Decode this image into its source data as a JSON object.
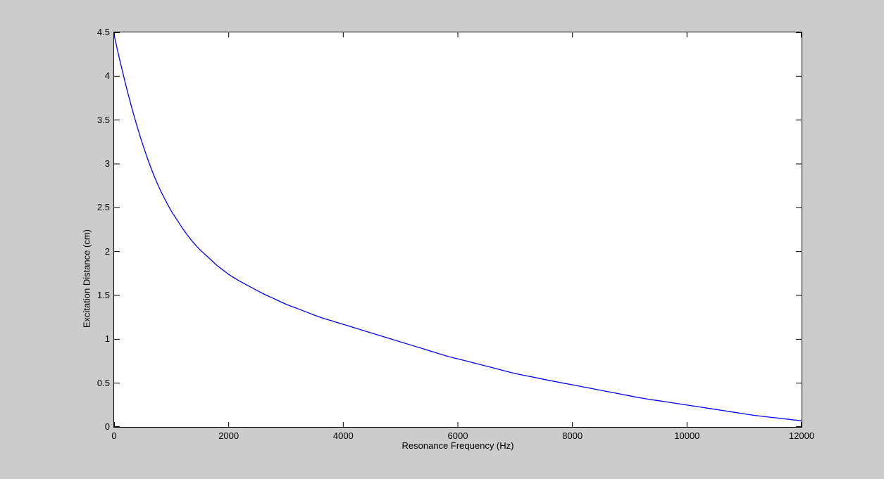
{
  "colors": {
    "figure_bg": "#cccccc",
    "plot_bg": "#ffffff",
    "axis_color": "#000000",
    "line_color": "#0000ff",
    "text_color": "#000000"
  },
  "chart_data": {
    "type": "line",
    "title": "",
    "xlabel": "Resonance Frequency (Hz)",
    "ylabel": "Excitation Distance (cm)",
    "xlim": [
      0,
      12000
    ],
    "ylim": [
      0,
      4.5
    ],
    "grid": false,
    "legend": "none",
    "box": true,
    "series": [
      {
        "name": "excitation-distance-vs-resonance-frequency",
        "color": "#0000ff",
        "points": [
          [
            0,
            4.47
          ],
          [
            100,
            4.18
          ],
          [
            200,
            3.91
          ],
          [
            300,
            3.66
          ],
          [
            400,
            3.43
          ],
          [
            500,
            3.22
          ],
          [
            600,
            3.03
          ],
          [
            700,
            2.86
          ],
          [
            800,
            2.71
          ],
          [
            900,
            2.58
          ],
          [
            1000,
            2.46
          ],
          [
            1100,
            2.36
          ],
          [
            1200,
            2.26
          ],
          [
            1300,
            2.17
          ],
          [
            1400,
            2.09
          ],
          [
            1500,
            2.02
          ],
          [
            1600,
            1.96
          ],
          [
            1700,
            1.9
          ],
          [
            1800,
            1.84
          ],
          [
            1900,
            1.79
          ],
          [
            2000,
            1.74
          ],
          [
            2200,
            1.66
          ],
          [
            2400,
            1.59
          ],
          [
            2600,
            1.52
          ],
          [
            2800,
            1.46
          ],
          [
            3000,
            1.4
          ],
          [
            3200,
            1.35
          ],
          [
            3400,
            1.3
          ],
          [
            3600,
            1.25
          ],
          [
            3800,
            1.21
          ],
          [
            4000,
            1.17
          ],
          [
            4300,
            1.11
          ],
          [
            4600,
            1.05
          ],
          [
            4900,
            0.99
          ],
          [
            5200,
            0.93
          ],
          [
            5500,
            0.87
          ],
          [
            5800,
            0.81
          ],
          [
            6100,
            0.76
          ],
          [
            6400,
            0.71
          ],
          [
            6700,
            0.66
          ],
          [
            7000,
            0.61
          ],
          [
            7300,
            0.57
          ],
          [
            7600,
            0.53
          ],
          [
            8000,
            0.48
          ],
          [
            8400,
            0.43
          ],
          [
            8800,
            0.38
          ],
          [
            9200,
            0.33
          ],
          [
            9600,
            0.29
          ],
          [
            10000,
            0.25
          ],
          [
            10400,
            0.21
          ],
          [
            10800,
            0.17
          ],
          [
            11200,
            0.13
          ],
          [
            11600,
            0.1
          ],
          [
            12000,
            0.07
          ]
        ]
      }
    ],
    "x_ticks": [
      {
        "value": 0,
        "label": "0"
      },
      {
        "value": 2000,
        "label": "2000"
      },
      {
        "value": 4000,
        "label": "4000"
      },
      {
        "value": 6000,
        "label": "6000"
      },
      {
        "value": 8000,
        "label": "8000"
      },
      {
        "value": 10000,
        "label": "10000"
      },
      {
        "value": 12000,
        "label": "12000"
      }
    ],
    "y_ticks": [
      {
        "value": 0,
        "label": "0"
      },
      {
        "value": 0.5,
        "label": "0.5"
      },
      {
        "value": 1,
        "label": "1"
      },
      {
        "value": 1.5,
        "label": "1.5"
      },
      {
        "value": 2,
        "label": "2"
      },
      {
        "value": 2.5,
        "label": "2.5"
      },
      {
        "value": 3,
        "label": "3"
      },
      {
        "value": 3.5,
        "label": "3.5"
      },
      {
        "value": 4,
        "label": "4"
      },
      {
        "value": 4.5,
        "label": "4.5"
      }
    ]
  }
}
